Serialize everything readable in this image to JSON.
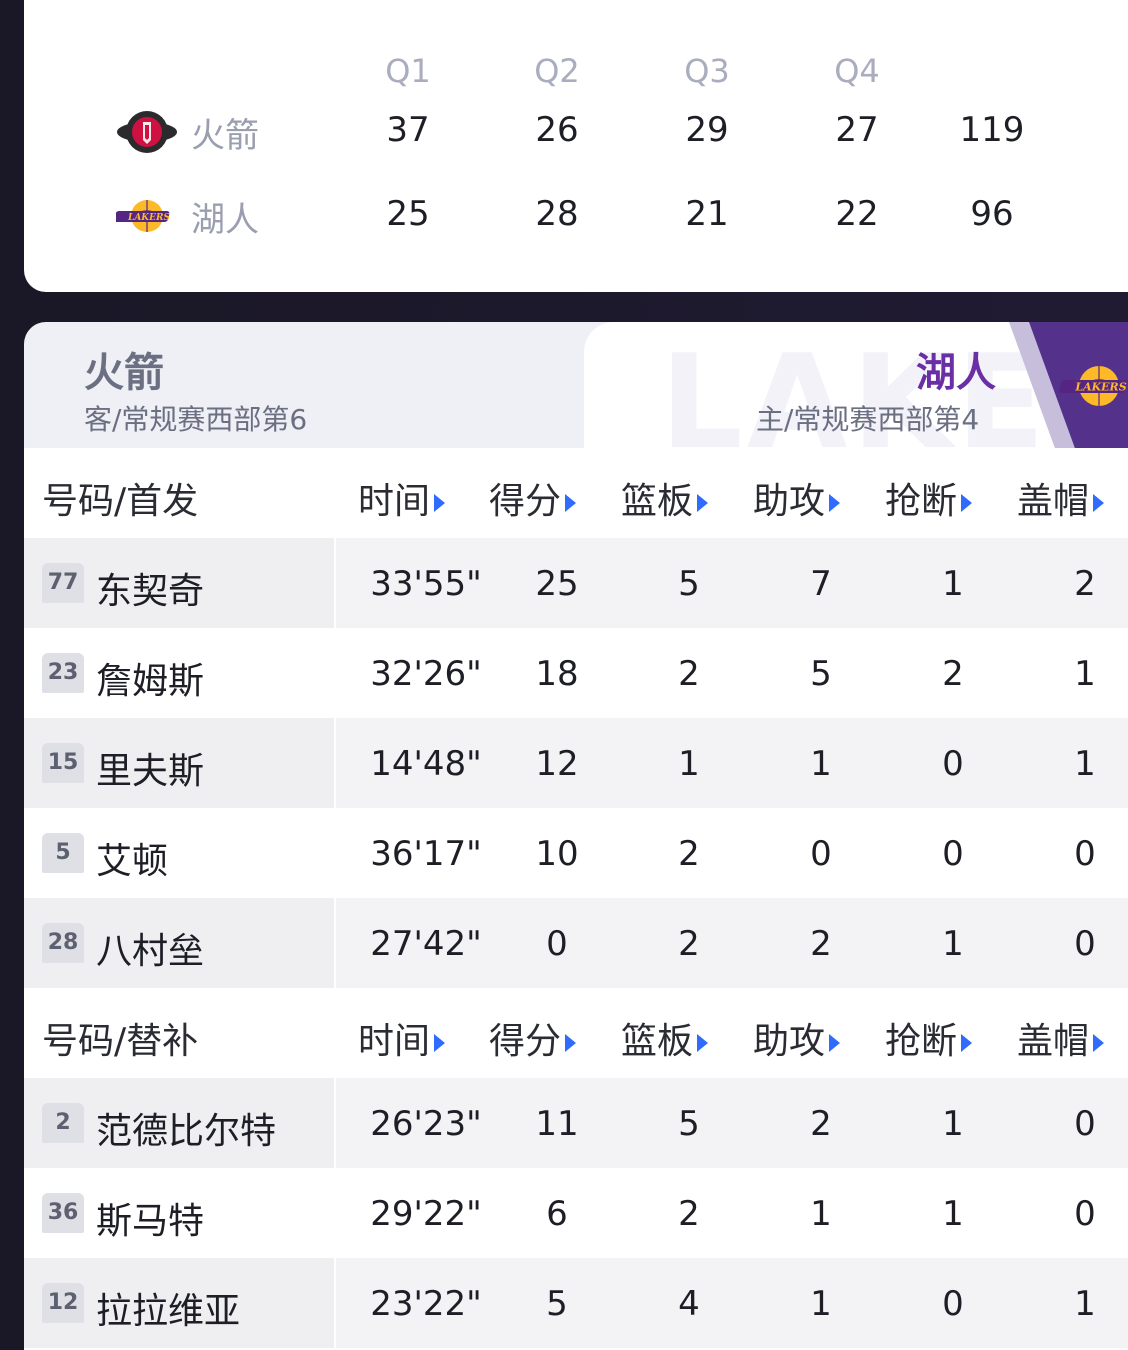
{
  "quarters": {
    "headers": [
      "Q1",
      "Q2",
      "Q3",
      "Q4"
    ],
    "teams": [
      {
        "name": "火箭",
        "logo": "rockets-logo",
        "scores": [
          "37",
          "26",
          "29",
          "27"
        ],
        "total": "119"
      },
      {
        "name": "湖人",
        "logo": "lakers-logo",
        "scores": [
          "25",
          "28",
          "21",
          "22"
        ],
        "total": "96"
      }
    ]
  },
  "matchup": {
    "away": {
      "name": "火箭",
      "subtitle": "客/常规赛西部第6"
    },
    "home": {
      "name": "湖人",
      "subtitle": "主/常规赛西部第4",
      "watermark": "LAKERS",
      "color": "#54328c"
    }
  },
  "columns": [
    "时间",
    "得分",
    "篮板",
    "助攻",
    "抢断",
    "盖帽"
  ],
  "starters": {
    "section_label": "号码/首发",
    "players": [
      {
        "number": "77",
        "name": "东契奇",
        "time": "33'55\"",
        "pts": "25",
        "reb": "5",
        "ast": "7",
        "stl": "1",
        "blk": "2"
      },
      {
        "number": "23",
        "name": "詹姆斯",
        "time": "32'26\"",
        "pts": "18",
        "reb": "2",
        "ast": "5",
        "stl": "2",
        "blk": "1"
      },
      {
        "number": "15",
        "name": "里夫斯",
        "time": "14'48\"",
        "pts": "12",
        "reb": "1",
        "ast": "1",
        "stl": "0",
        "blk": "1"
      },
      {
        "number": "5",
        "name": "艾顿",
        "time": "36'17\"",
        "pts": "10",
        "reb": "2",
        "ast": "0",
        "stl": "0",
        "blk": "0"
      },
      {
        "number": "28",
        "name": "八村垒",
        "time": "27'42\"",
        "pts": "0",
        "reb": "2",
        "ast": "2",
        "stl": "1",
        "blk": "0"
      }
    ]
  },
  "bench": {
    "section_label": "号码/替补",
    "players": [
      {
        "number": "2",
        "name": "范德比尔特",
        "time": "26'23\"",
        "pts": "11",
        "reb": "5",
        "ast": "2",
        "stl": "1",
        "blk": "0"
      },
      {
        "number": "36",
        "name": "斯马特",
        "time": "29'22\"",
        "pts": "6",
        "reb": "2",
        "ast": "1",
        "stl": "1",
        "blk": "0"
      },
      {
        "number": "12",
        "name": "拉拉维亚",
        "time": "23'22\"",
        "pts": "5",
        "reb": "4",
        "ast": "1",
        "stl": "0",
        "blk": "1"
      }
    ]
  }
}
